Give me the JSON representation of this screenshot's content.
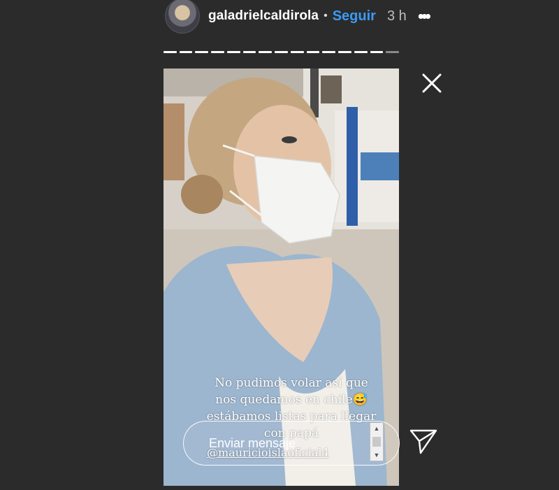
{
  "header": {
    "username": "galadrielcaldirola",
    "separator": "•",
    "follow_label": "Seguir",
    "time": "3 h",
    "more_icon": "more-horizontal-icon"
  },
  "story": {
    "caption_lines": [
      "No pudimos volar así que",
      "nos quedamos en chile😅",
      "estábamos listas para llegar",
      "con papá"
    ],
    "mention": "@mauricioislaoficial4"
  },
  "reply": {
    "placeholder": "Enviar mensaje"
  },
  "colors": {
    "background": "#2b2b2b",
    "follow_accent": "#3b9bf4"
  }
}
